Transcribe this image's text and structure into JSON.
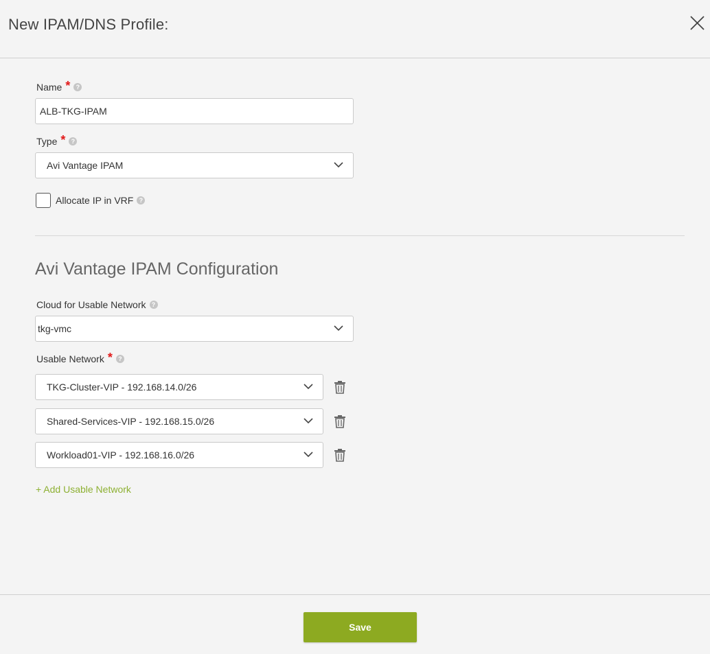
{
  "header": {
    "title": "New IPAM/DNS Profile:"
  },
  "form": {
    "name": {
      "label": "Name",
      "value": "ALB-TKG-IPAM"
    },
    "type": {
      "label": "Type",
      "value": "Avi Vantage IPAM"
    },
    "allocate_ip_vrf": {
      "label": "Allocate IP in VRF",
      "checked": false
    }
  },
  "ipam_config": {
    "section_title": "Avi Vantage IPAM Configuration",
    "cloud": {
      "label": "Cloud for Usable Network",
      "value": "tkg-vmc"
    },
    "usable_network": {
      "label": "Usable Network",
      "items": [
        {
          "value": "TKG-Cluster-VIP - 192.168.14.0/26"
        },
        {
          "value": "Shared-Services-VIP - 192.168.15.0/26"
        },
        {
          "value": "Workload01-VIP - 192.168.16.0/26"
        }
      ],
      "add_label": "+ Add Usable Network"
    }
  },
  "footer": {
    "save_label": "Save"
  },
  "colors": {
    "accent": "#8daa21",
    "required": "#e21a1a",
    "link": "#8db032"
  },
  "icons": [
    "close-icon",
    "help-icon",
    "chevron-down-icon",
    "trash-icon"
  ]
}
